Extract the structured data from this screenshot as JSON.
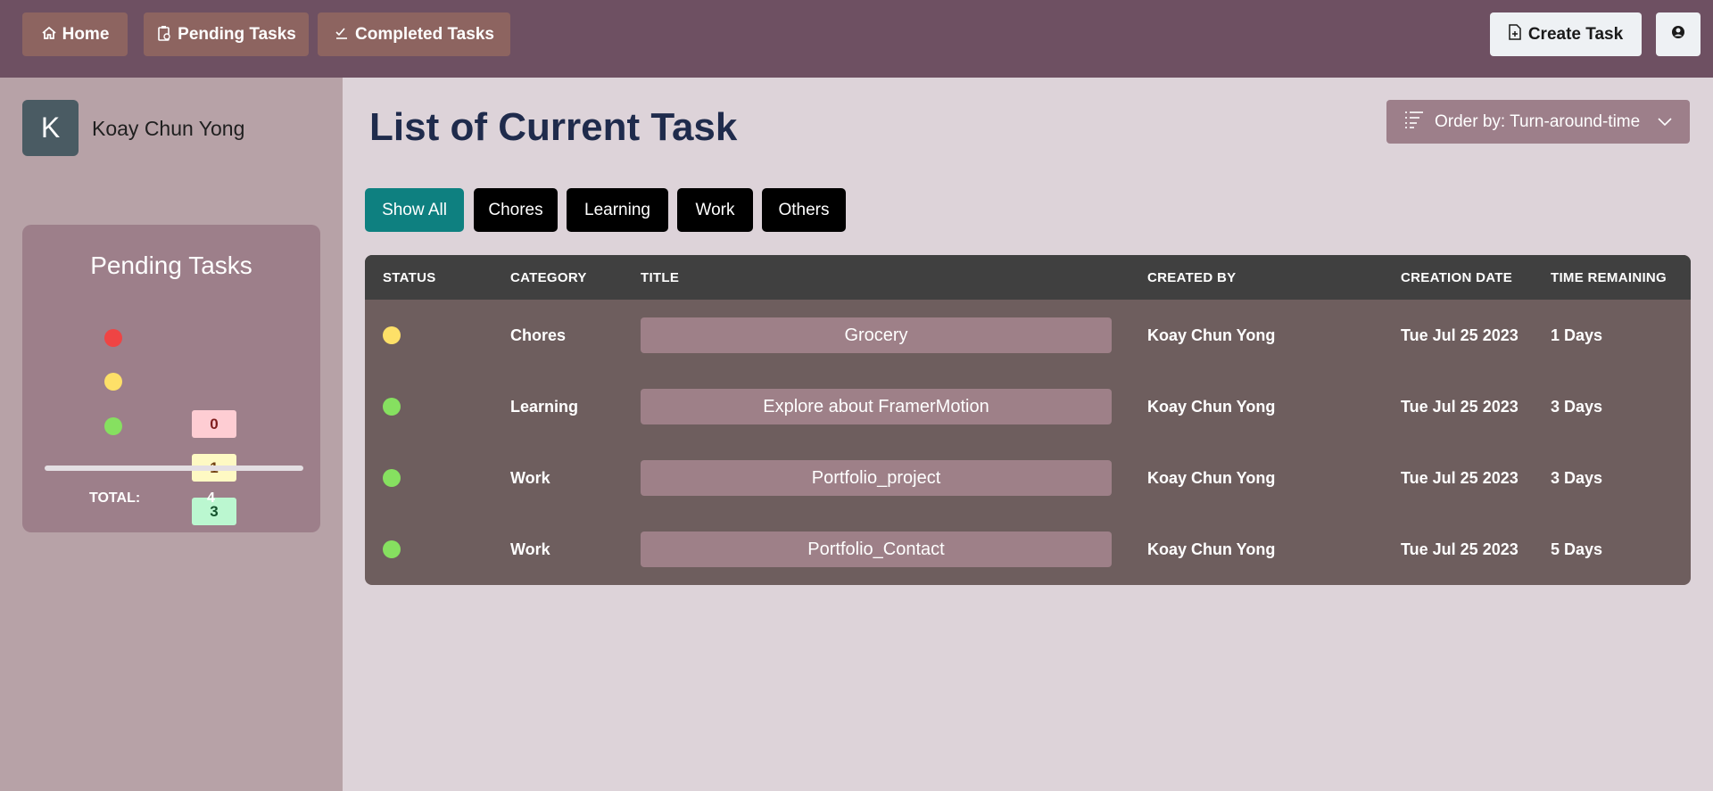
{
  "nav": {
    "home": "Home",
    "pending": "Pending Tasks",
    "completed": "Completed Tasks",
    "create": "Create Task"
  },
  "sidebar": {
    "avatar_letter": "K",
    "username": "Koay Chun Yong",
    "pending_card": {
      "title": "Pending Tasks",
      "red_count": "0",
      "yellow_count": "1",
      "green_count": "3",
      "total_label": "TOTAL:",
      "total_value": "4"
    }
  },
  "main": {
    "title": "List of Current Task",
    "order_by": "Order by: Turn-around-time",
    "filters": [
      "Show All",
      "Chores",
      "Learning",
      "Work",
      "Others"
    ],
    "active_filter": "Show All",
    "columns": [
      "STATUS",
      "CATEGORY",
      "TITLE",
      "CREATED BY",
      "CREATION DATE",
      "TIME REMAINING"
    ],
    "rows": [
      {
        "status": "yellow",
        "category": "Chores",
        "title": "Grocery",
        "created_by": "Koay Chun Yong",
        "creation_date": "Tue Jul 25 2023",
        "time_remaining": "1 Days"
      },
      {
        "status": "green",
        "category": "Learning",
        "title": "Explore about FramerMotion",
        "created_by": "Koay Chun Yong",
        "creation_date": "Tue Jul 25 2023",
        "time_remaining": "3 Days"
      },
      {
        "status": "green",
        "category": "Work",
        "title": "Portfolio_project",
        "created_by": "Koay Chun Yong",
        "creation_date": "Tue Jul 25 2023",
        "time_remaining": "3 Days"
      },
      {
        "status": "green",
        "category": "Work",
        "title": "Portfolio_Contact",
        "created_by": "Koay Chun Yong",
        "creation_date": "Tue Jul 25 2023",
        "time_remaining": "5 Days"
      }
    ]
  },
  "colors": {
    "topbar": "#6e5062",
    "nav_button": "#8d6460",
    "active_filter": "#0e8080",
    "status_red": "#ef4444",
    "status_yellow": "#fde068",
    "status_green": "#86e060"
  },
  "icons": {
    "home": "home-icon",
    "pending": "clipboard-icon",
    "completed": "checklist-icon",
    "create": "file-plus-icon",
    "user": "user-circle-icon",
    "order": "list-icon",
    "order_chevron": "chevron-down-icon"
  }
}
